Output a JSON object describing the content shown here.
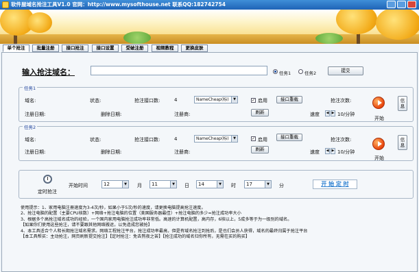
{
  "window": {
    "title": "软件屋域名抢注工具V1.0 官网：http://www.mysofthouse.net 联系QQ:182742754"
  },
  "tabs": [
    "单个抢注",
    "批量注册",
    "接口抢注",
    "接口设置",
    "受破注册",
    "视频教程",
    "更换皮肤"
  ],
  "main": {
    "domain_label": "输入抢注域名：",
    "domain_value": "",
    "radio1": "任务1",
    "radio2": "任务2",
    "submit": "提交"
  },
  "task1": {
    "title": "任务1",
    "domain_label": "域名:",
    "status_label": "状态:",
    "api_count_label": "抢注接口数:",
    "api_count": "4",
    "registrar": "NameCheap(标)",
    "enable": "启用",
    "api_reload": "接口重载",
    "attempts_label": "抢注次数:",
    "reg_date_label": "注册日期:",
    "del_date_label": "删除日期:",
    "registrar_label": "注册商:",
    "refresh": "刷新",
    "speed_label": "速度",
    "speed_value": "10/分钟",
    "start": "开始",
    "info": "信息"
  },
  "task2": {
    "title": "任务2",
    "domain_label": "域名:",
    "status_label": "状态:",
    "api_count_label": "抢注接口数:",
    "api_count": "4",
    "registrar": "NameCheap(标)",
    "enable": "启用",
    "api_reload": "接口重载",
    "attempts_label": "抢注次数:",
    "reg_date_label": "注册日期:",
    "del_date_label": "删除日期:",
    "registrar_label": "注册商:",
    "refresh": "刷新",
    "speed_label": "速度",
    "speed_value": "10/分钟",
    "start": "开始",
    "info": "信息"
  },
  "timer": {
    "label": "定时抢注",
    "start_time_label": "开始时间",
    "month": "12",
    "month_unit": "月",
    "day": "11",
    "day_unit": "日",
    "hour": "14",
    "hour_unit": "时",
    "minute": "17",
    "minute_unit": "分",
    "start_link": "开 始 定 时"
  },
  "tips": [
    "使用提示：1、家用电脑注册速度为3-4次/秒，如果小于5次/秒的速度，请更换电脑提高抢注速度。",
    "2、抢注电脑的配置（主要CPU核数）+网络+抢注电脑的位置（美国服务器最佳）+抢注电脑的多少=抢注成功率大小",
    "3、根据多个高抢注域名成功的经验，一个国内家用电脑抢注成功率非常低。高速的计算机配置，高内存，6核以上，5成多等于为一级别的域名。",
    "【如果你们使用这些抢注，请不要跟其他网络搬运，以免造成您被抢】",
    "4、本工具适合个人和长期抢注域名需求。网络工程抢注平台，抢注成功率最高，但是有域名抢注到抢后，是也们会员人获得，域名的最终归属于抢注平台",
    "【本工具帮买：主动抢注，网页刷新提交抢注】【定时抢注：免去熬夜之苦】【抢注成功的域名归你所有，无需在买的购买】"
  ]
}
